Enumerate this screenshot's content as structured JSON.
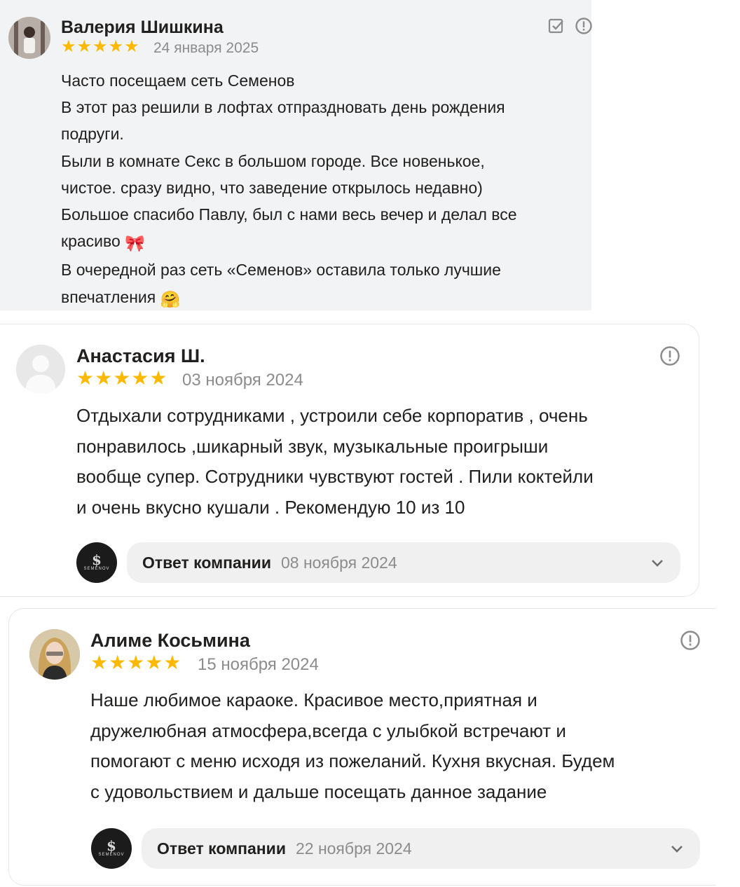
{
  "reviews": [
    {
      "author": "Валерия Шишкина",
      "stars": "★★★★★",
      "rating": 5,
      "date": "24 января 2025",
      "lines": [
        "Часто посещаем сеть Семенов",
        "В этот раз решили в лофтах отпраздновать день рождения",
        "подруги.",
        "Были в комнате Секс в большом городе. Все новенькое,",
        "чистое. сразу видно, что заведение открылось недавно)",
        "Большое спасибо Павлу, был с нами весь вечер и делал все",
        "красиво",
        "В очередной раз сеть «Семенов» оставила только лучшие",
        "впечатления"
      ],
      "emojis": [
        "🎀",
        "🤗"
      ],
      "icons": [
        "edit-check-icon",
        "report-icon"
      ]
    },
    {
      "author": "Анастасия Ш.",
      "stars": "★★★★★",
      "rating": 5,
      "date": "03 ноября 2024",
      "lines": [
        "Отдыхали сотрудниками , устроили себе корпоратив , очень",
        "понравилось ,шикарный звук, музыкальные проигрыши",
        "вообще супер. Сотрудники чувствуют гостей . Пили коктейли",
        "и очень вкусно кушали . Рекомендую 10 из 10"
      ],
      "reply": {
        "label": "Ответ компании",
        "date": "08 ноября 2024",
        "logo_letter": "$",
        "logo_word": "SEMENOV"
      }
    },
    {
      "author": "Алиме Косьмина",
      "stars": "★★★★★",
      "rating": 5,
      "date": "15 ноября 2024",
      "lines": [
        "Наше любимое караоке. Красивое место,приятная и",
        "дружелюбная атмосфера,всегда с улыбкой встречают и",
        "помогают с меню исходя из пожеланий. Кухня вкусная. Будем",
        "с удовольствием и дальше посещать данное задание"
      ],
      "reply": {
        "label": "Ответ компании",
        "date": "22 ноября 2024",
        "logo_letter": "$",
        "logo_word": "SEMENOV"
      }
    }
  ],
  "colors": {
    "star": "#fcb900",
    "muted": "#8c8c8c",
    "text": "#21201f",
    "card_gray": "#f2f3f5",
    "reply_bg": "#f0f0f0"
  }
}
